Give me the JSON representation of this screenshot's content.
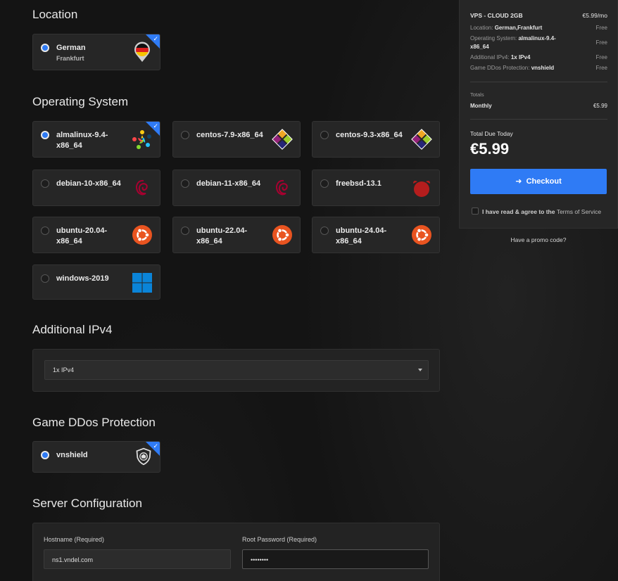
{
  "sections": {
    "location": "Location",
    "os": "Operating System",
    "ipv4": "Additional IPv4",
    "ddos": "Game DDos Protection",
    "server": "Server Configuration"
  },
  "location": {
    "name": "German",
    "city": "Frankfurt",
    "icon": "germany-flag-pin-icon"
  },
  "os_options": [
    {
      "label": "almalinux-9.4-x86_64",
      "icon": "almalinux-icon",
      "selected": true
    },
    {
      "label": "centos-7.9-x86_64",
      "icon": "centos-icon",
      "selected": false
    },
    {
      "label": "centos-9.3-x86_64",
      "icon": "centos-icon",
      "selected": false
    },
    {
      "label": "debian-10-x86_64",
      "icon": "debian-icon",
      "selected": false
    },
    {
      "label": "debian-11-x86_64",
      "icon": "debian-icon",
      "selected": false
    },
    {
      "label": "freebsd-13.1",
      "icon": "freebsd-icon",
      "selected": false
    },
    {
      "label": "ubuntu-20.04-x86_64",
      "icon": "ubuntu-icon",
      "selected": false
    },
    {
      "label": "ubuntu-22.04-x86_64",
      "icon": "ubuntu-icon",
      "selected": false
    },
    {
      "label": "ubuntu-24.04-x86_64",
      "icon": "ubuntu-icon",
      "selected": false
    },
    {
      "label": "windows-2019",
      "icon": "windows-icon",
      "selected": false
    }
  ],
  "ipv4": {
    "selected": "1x IPv4"
  },
  "ddos": {
    "name": "vnshield",
    "icon": "shield-icon"
  },
  "server_config": {
    "hostname_label": "Hostname (Required)",
    "hostname_value": "ns1.vndel.com",
    "password_label": "Root Password (Required)",
    "password_value": "••••••••"
  },
  "summary": {
    "product": "VPS - CLOUD 2GB",
    "product_price": "€5.99/mo",
    "lines": [
      {
        "key": "Location:",
        "value": "German,Frankfurt",
        "price": "Free"
      },
      {
        "key": "Operating System:",
        "value": "almalinux-9.4-x86_64",
        "price": "Free"
      },
      {
        "key": "Additional IPv4:",
        "value": "1x IPv4",
        "price": "Free"
      },
      {
        "key": "Game DDos Protection:",
        "value": "vnshield",
        "price": "Free"
      }
    ],
    "totals_label": "Totals",
    "monthly_label": "Monthly",
    "monthly_value": "€5.99",
    "due_label": "Total Due Today",
    "due_value": "€5.99",
    "checkout_label": "Checkout",
    "tos_text": "I have read & agree to the",
    "tos_link": "Terms of Service",
    "promo": "Have a promo code?"
  },
  "colors": {
    "accent": "#2f7bf5",
    "card_bg": "#262626",
    "page_bg": "#141414"
  }
}
